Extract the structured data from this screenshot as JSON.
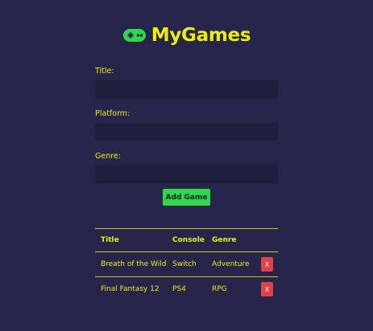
{
  "app": {
    "title": "MyGames",
    "logo_icon": "gamepad-icon"
  },
  "form": {
    "title_label": "Title:",
    "title_value": "",
    "platform_label": "Platform:",
    "platform_value": "",
    "genre_label": "Genre:",
    "genre_value": "",
    "add_button_label": "Add Game"
  },
  "table": {
    "headers": {
      "title": "Title",
      "console": "Console",
      "genre": "Genre"
    },
    "rows": [
      {
        "title": "Breath of the Wild",
        "console": "Switch",
        "genre": "Adventure",
        "delete_label": "X"
      },
      {
        "title": "Final Fantasy 12",
        "console": "PS4",
        "genre": "RPG",
        "delete_label": "X"
      }
    ]
  },
  "colors": {
    "background": "#27254a",
    "accent_text": "#eded0a",
    "add_button": "#2fd84a",
    "delete_button": "#e0424c",
    "input_background": "#201e3d"
  }
}
